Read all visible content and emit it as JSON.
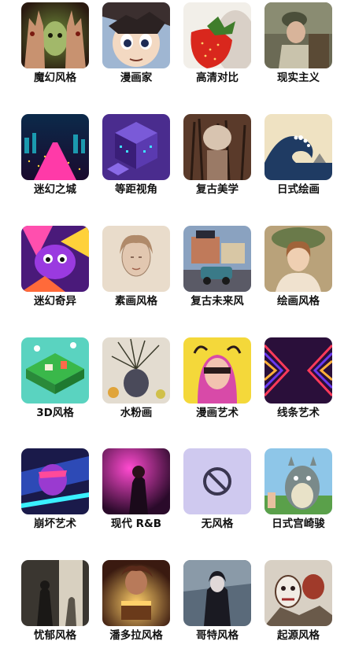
{
  "styles": [
    {
      "label": "魔幻风格",
      "image": "magic-style-thumbnail"
    },
    {
      "label": "漫画家",
      "image": "manga-artist-thumbnail"
    },
    {
      "label": "高清对比",
      "image": "hd-contrast-thumbnail"
    },
    {
      "label": "现实主义",
      "image": "realism-thumbnail"
    },
    {
      "label": "迷幻之城",
      "image": "psychedelic-city-thumbnail"
    },
    {
      "label": "等距视角",
      "image": "isometric-view-thumbnail"
    },
    {
      "label": "复古美学",
      "image": "retro-aesthetics-thumbnail"
    },
    {
      "label": "日式绘画",
      "image": "japanese-painting-thumbnail"
    },
    {
      "label": "迷幻奇异",
      "image": "psychedelic-weird-thumbnail"
    },
    {
      "label": "素画风格",
      "image": "sketch-style-thumbnail"
    },
    {
      "label": "复古未来风",
      "image": "retro-futurism-thumbnail"
    },
    {
      "label": "绘画风格",
      "image": "painting-style-thumbnail"
    },
    {
      "label": "3D风格",
      "image": "3d-style-thumbnail"
    },
    {
      "label": "水粉画",
      "image": "gouache-thumbnail"
    },
    {
      "label": "漫画艺术",
      "image": "comic-art-thumbnail"
    },
    {
      "label": "线条艺术",
      "image": "line-art-thumbnail"
    },
    {
      "label": "崩坏艺术",
      "image": "glitch-art-thumbnail"
    },
    {
      "label": "现代 R&B",
      "image": "modern-rnb-thumbnail"
    },
    {
      "label": "无风格",
      "image": "no-style-icon"
    },
    {
      "label": "日式宫崎骏",
      "image": "miyazaki-style-thumbnail"
    },
    {
      "label": "忧郁风格",
      "image": "melancholy-style-thumbnail"
    },
    {
      "label": "潘多拉风格",
      "image": "pandora-style-thumbnail"
    },
    {
      "label": "哥特风格",
      "image": "gothic-style-thumbnail"
    },
    {
      "label": "起源风格",
      "image": "origin-style-thumbnail"
    }
  ],
  "colors": {
    "label_text": "#111111",
    "no_style_bg": "#cfc9ef",
    "no_style_icon": "#3a3650"
  }
}
